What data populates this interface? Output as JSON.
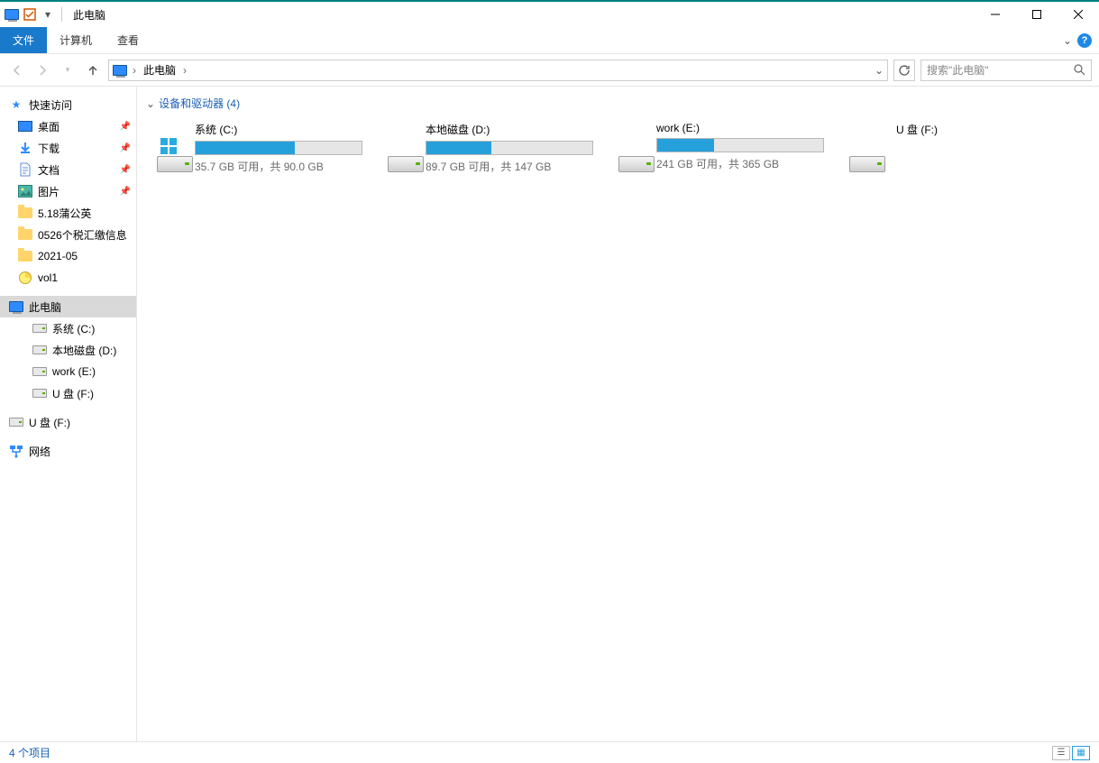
{
  "window": {
    "title": "此电脑"
  },
  "ribbon": {
    "file": "文件",
    "computer": "计算机",
    "view": "查看"
  },
  "breadcrumb": {
    "root": "此电脑"
  },
  "search": {
    "placeholder": "搜索\"此电脑\""
  },
  "sidebar": {
    "quick_access": "快速访问",
    "pinned": [
      {
        "label": "桌面",
        "icon": "desktop"
      },
      {
        "label": "下载",
        "icon": "download"
      },
      {
        "label": "文档",
        "icon": "document"
      },
      {
        "label": "图片",
        "icon": "picture"
      }
    ],
    "recent": [
      {
        "label": "5.18蒲公英"
      },
      {
        "label": "0526个税汇缴信息"
      },
      {
        "label": "2021-05"
      },
      {
        "label": "vol1",
        "icon": "disk"
      }
    ],
    "this_pc": "此电脑",
    "drives": [
      {
        "label": "系统 (C:)"
      },
      {
        "label": "本地磁盘 (D:)"
      },
      {
        "label": "work (E:)"
      },
      {
        "label": "U 盘 (F:)"
      }
    ],
    "removable": "U 盘 (F:)",
    "network": "网络"
  },
  "content": {
    "group_title": "设备和驱动器 (4)",
    "drives": [
      {
        "name": "系统 (C:)",
        "stats": "35.7 GB 可用，共 90.0 GB",
        "used_pct": 60,
        "has_winlogo": true
      },
      {
        "name": "本地磁盘 (D:)",
        "stats": "89.7 GB 可用，共 147 GB",
        "used_pct": 39,
        "has_winlogo": false
      },
      {
        "name": "work (E:)",
        "stats": "241 GB 可用，共 365 GB",
        "used_pct": 34,
        "has_winlogo": false
      },
      {
        "name": "U 盘 (F:)",
        "stats": "",
        "used_pct": null,
        "has_winlogo": false
      }
    ]
  },
  "status": {
    "count": "4 个项目"
  }
}
